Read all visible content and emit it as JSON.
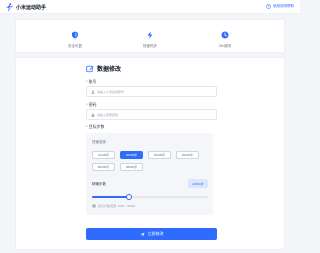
{
  "colors": {
    "accent": "#2f6bff",
    "required": "#ef4444"
  },
  "header": {
    "brand_icon": "runner-icon",
    "brand_name": "小米运动助手",
    "help_icon": "help-circle-icon",
    "help_text": "使用说明帮助"
  },
  "features": [
    {
      "icon": "shield-icon",
      "label": "安全可靠"
    },
    {
      "icon": "lightning-icon",
      "label": "快速同步"
    },
    {
      "icon": "clock-icon",
      "label": "24h服务"
    }
  ],
  "form": {
    "title_icon": "edit-icon",
    "title": "数据修改",
    "required_mark": "*",
    "account": {
      "label": "账号",
      "placeholder": "请输入小米运动账号"
    },
    "password": {
      "label": "密码",
      "placeholder": "请输入登录密码"
    },
    "target": {
      "label": "目标步数",
      "preset_header": "快速选择",
      "options": [
        "10000步",
        "20000步",
        "30000步",
        "50000步",
        "80000步",
        "98800步"
      ],
      "selected_index": 1,
      "custom_label": "精确步数",
      "custom_value": "20000步",
      "slider_fraction": 0.32,
      "hint": "建议步数范围: 1000 - 98800"
    },
    "submit_label": "立即修改"
  }
}
